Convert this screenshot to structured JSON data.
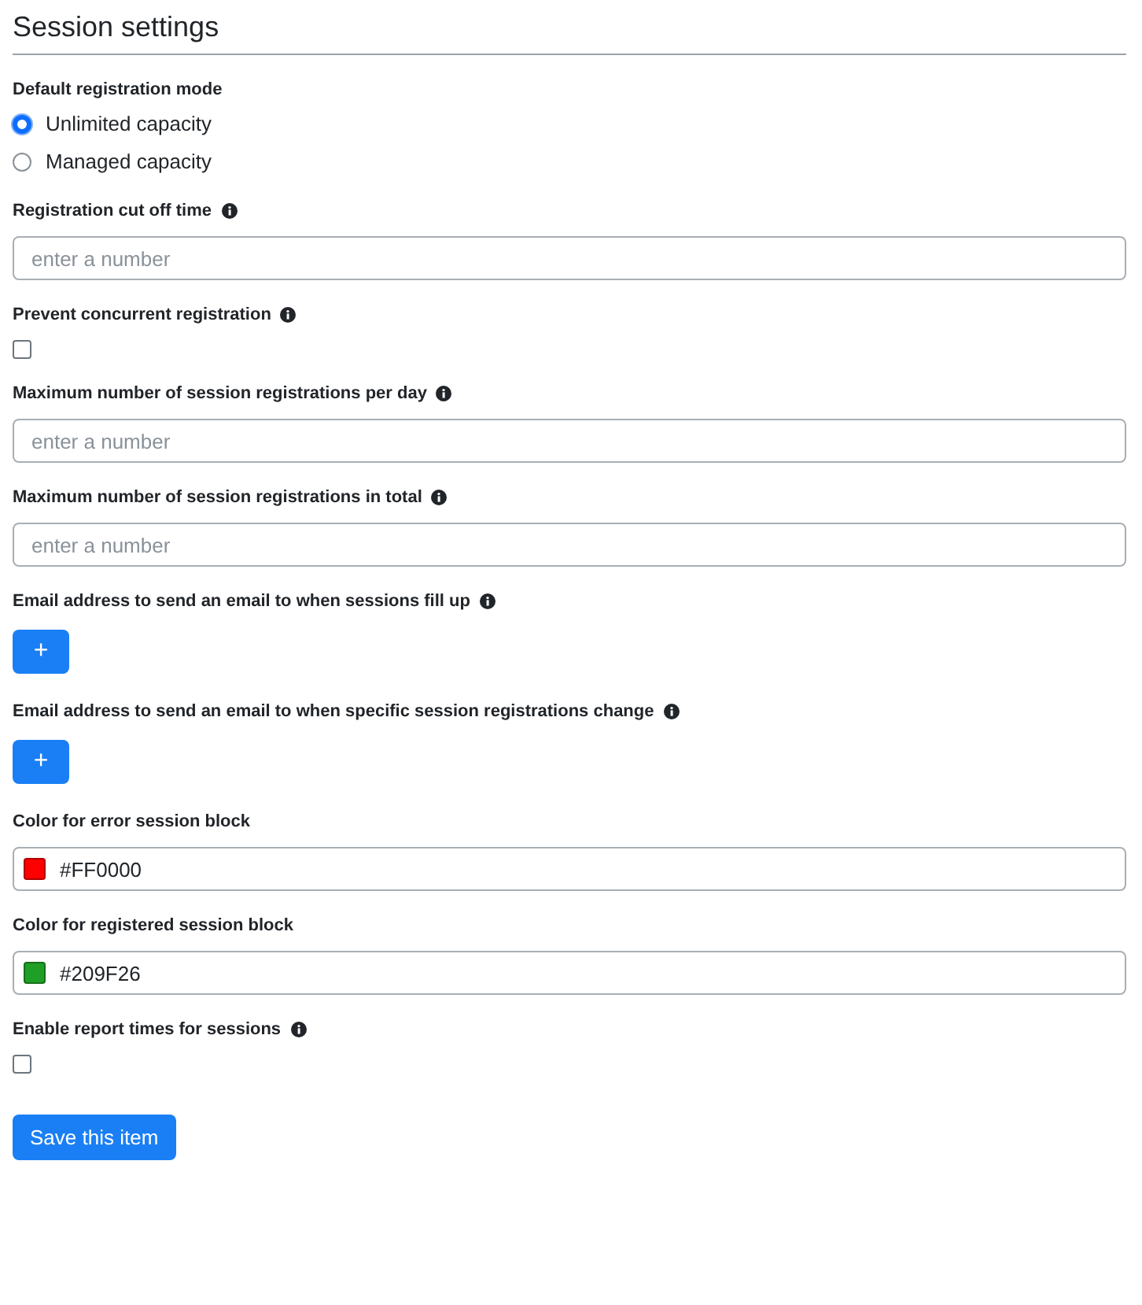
{
  "title": "Session settings",
  "fields": [
    {
      "kind": "radio",
      "label": "Default registration mode",
      "info": false,
      "options": [
        {
          "label": "Unlimited capacity",
          "selected": true
        },
        {
          "label": "Managed capacity",
          "selected": false
        }
      ]
    },
    {
      "kind": "number",
      "label": "Registration cut off time",
      "info": true,
      "placeholder": "enter a number"
    },
    {
      "kind": "checkbox",
      "label": "Prevent concurrent registration",
      "info": true,
      "checked": false
    },
    {
      "kind": "number",
      "label": "Maximum number of session registrations per day",
      "info": true,
      "placeholder": "enter a number"
    },
    {
      "kind": "number",
      "label": "Maximum number of session registrations in total",
      "info": true,
      "placeholder": "enter a number"
    },
    {
      "kind": "add",
      "label": "Email address to send an email to when sessions fill up",
      "info": true,
      "button": "+"
    },
    {
      "kind": "add",
      "label": "Email address to send an email to when specific session registrations change",
      "info": true,
      "button": "+"
    },
    {
      "kind": "color",
      "label": "Color for error session block",
      "info": false,
      "value": "#FF0000",
      "color": "#ff0000"
    },
    {
      "kind": "color",
      "label": "Color for registered session block",
      "info": false,
      "value": "#209F26",
      "color": "#209f26"
    },
    {
      "kind": "checkbox",
      "label": "Enable report times for sessions",
      "info": true,
      "checked": false
    }
  ],
  "save_button": "Save this item"
}
